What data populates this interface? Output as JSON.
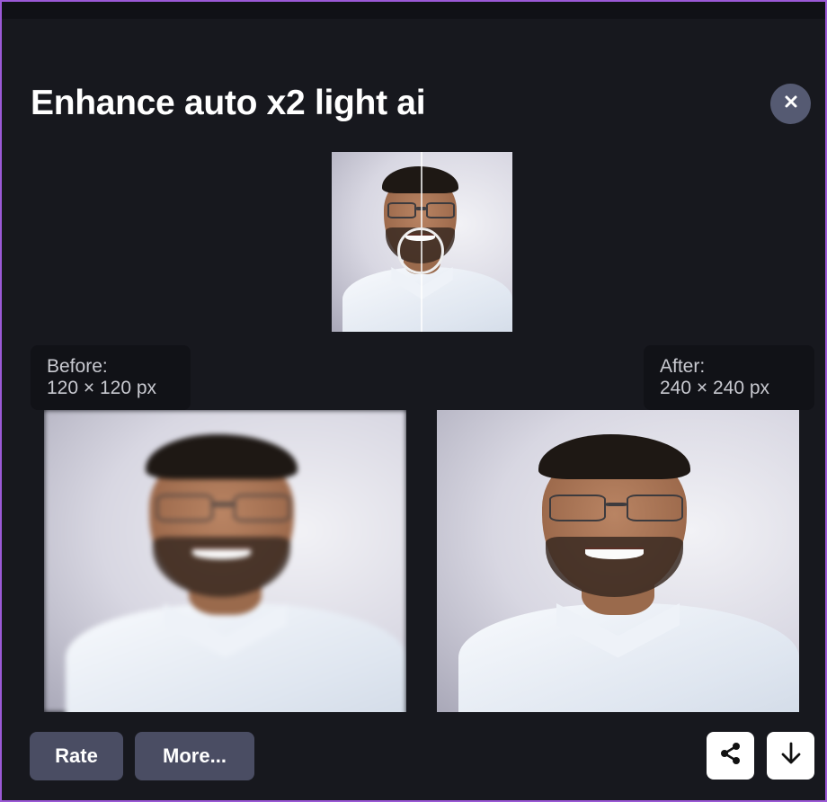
{
  "dialog": {
    "title": "Enhance auto x2 light ai",
    "close_icon": "close-icon"
  },
  "preview": {
    "image": "portrait-comparison-thumbnail",
    "compare_handle_icon": "compare-slider-handle"
  },
  "before": {
    "heading": "Before:",
    "size": "120 × 120 px",
    "image": "portrait-before-low-resolution"
  },
  "after": {
    "heading": "After:",
    "size": "240 × 240 px",
    "image": "portrait-after-enhanced"
  },
  "actions": {
    "rate_label": "Rate",
    "more_label": "More...",
    "share_icon": "share-icon",
    "download_icon": "download-icon"
  },
  "colors": {
    "background": "#17181e",
    "button": "#4a4d63",
    "close_button": "#555a72",
    "border": "#9b59d6"
  }
}
